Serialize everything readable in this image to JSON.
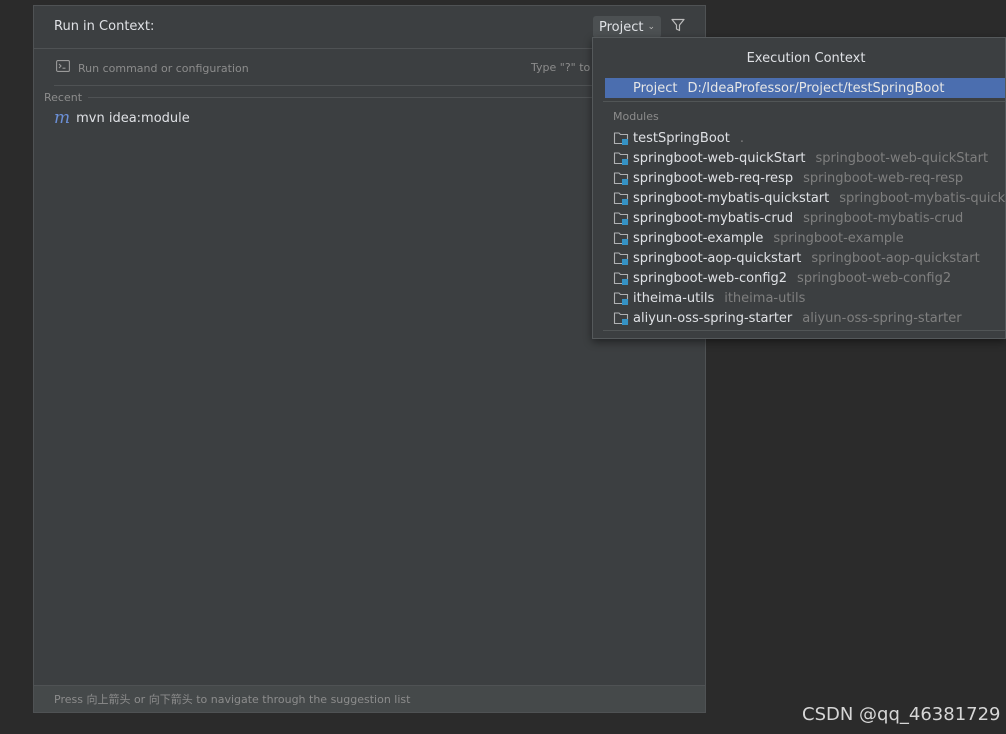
{
  "panel": {
    "title": "Run in Context:",
    "context_dropdown": "Project",
    "search": {
      "placeholder": "Run command or configuration",
      "value": ""
    },
    "hint": "Type \"?\" to",
    "recent_label": "Recent",
    "recent_items": [
      {
        "label": "mvn idea:module",
        "icon": "maven-icon"
      }
    ],
    "footer": "Press 向上箭头 or 向下箭头 to navigate through the suggestion list"
  },
  "popup": {
    "title": "Execution Context",
    "project": {
      "label": "Project",
      "path": "D:/IdeaProfessor/Project/testSpringBoot"
    },
    "modules_label": "Modules",
    "modules": [
      {
        "name": "testSpringBoot",
        "path": "."
      },
      {
        "name": "springboot-web-quickStart",
        "path": "springboot-web-quickStart"
      },
      {
        "name": "springboot-web-req-resp",
        "path": "springboot-web-req-resp"
      },
      {
        "name": "springboot-mybatis-quickstart",
        "path": "springboot-mybatis-quickst"
      },
      {
        "name": "springboot-mybatis-crud",
        "path": "springboot-mybatis-crud"
      },
      {
        "name": "springboot-example",
        "path": "springboot-example"
      },
      {
        "name": "springboot-aop-quickstart",
        "path": "springboot-aop-quickstart"
      },
      {
        "name": "springboot-web-config2",
        "path": "springboot-web-config2"
      },
      {
        "name": "itheima-utils",
        "path": "itheima-utils"
      },
      {
        "name": "aliyun-oss-spring-starter",
        "path": "aliyun-oss-spring-starter"
      }
    ]
  },
  "watermark": "CSDN @qq_46381729",
  "colors": {
    "background": "#2b2b2b",
    "panel": "#3c3f41",
    "selection": "#4b6eaf",
    "text": "#dfe1e5",
    "muted": "#8c8c8c",
    "maven_accent": "#6b8fd6"
  }
}
